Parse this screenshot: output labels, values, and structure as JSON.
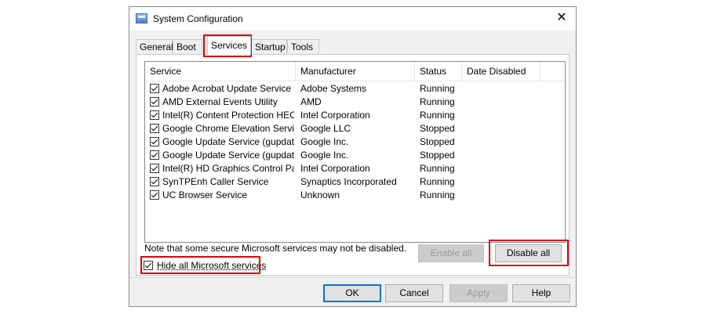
{
  "window": {
    "title": "System Configuration"
  },
  "tabs": [
    {
      "label": "General",
      "active": false
    },
    {
      "label": "Boot",
      "active": false
    },
    {
      "label": "Services",
      "active": true
    },
    {
      "label": "Startup",
      "active": false
    },
    {
      "label": "Tools",
      "active": false
    }
  ],
  "columns": [
    "Service",
    "Manufacturer",
    "Status",
    "Date Disabled"
  ],
  "services": [
    {
      "name": "Adobe Acrobat Update Service",
      "manufacturer": "Adobe Systems",
      "status": "Running",
      "checked": true
    },
    {
      "name": "AMD External Events Utility",
      "manufacturer": "AMD",
      "status": "Running",
      "checked": true
    },
    {
      "name": "Intel(R) Content Protection HEC...",
      "manufacturer": "Intel Corporation",
      "status": "Running",
      "checked": true
    },
    {
      "name": "Google Chrome Elevation Service",
      "manufacturer": "Google LLC",
      "status": "Stopped",
      "checked": true
    },
    {
      "name": "Google Update Service (gupdate)",
      "manufacturer": "Google Inc.",
      "status": "Stopped",
      "checked": true
    },
    {
      "name": "Google Update Service (gupdatem)",
      "manufacturer": "Google Inc.",
      "status": "Stopped",
      "checked": true
    },
    {
      "name": "Intel(R) HD Graphics Control Pa...",
      "manufacturer": "Intel Corporation",
      "status": "Running",
      "checked": true
    },
    {
      "name": "SynTPEnh Caller Service",
      "manufacturer": "Synaptics Incorporated",
      "status": "Running",
      "checked": true
    },
    {
      "name": "UC Browser Service",
      "manufacturer": "Unknown",
      "status": "Running",
      "checked": true
    }
  ],
  "note": "Note that some secure Microsoft services may not be disabled.",
  "buttons": {
    "enable_all": "Enable all",
    "disable_all": "Disable all",
    "ok": "OK",
    "cancel": "Cancel",
    "apply": "Apply",
    "help": "Help"
  },
  "hide_ms": {
    "label": "Hide all Microsoft services",
    "checked": true
  },
  "colors": {
    "highlight": "#e00000",
    "accent": "#0078d7"
  }
}
